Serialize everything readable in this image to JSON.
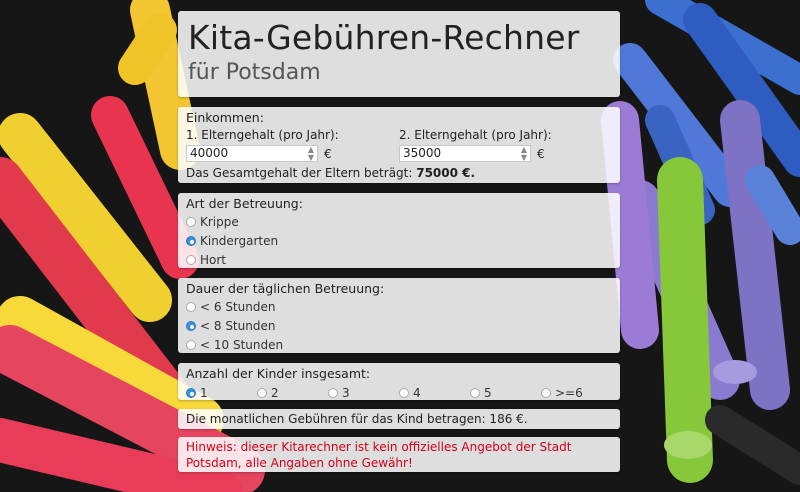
{
  "header": {
    "title": "Kita-Gebühren-Rechner",
    "subtitle": "für Potsdam"
  },
  "income": {
    "title": "Einkommen:",
    "parent1_label": "1. Elterngehalt (pro Jahr):",
    "parent1_value": "40000",
    "parent2_label": "2. Elterngehalt (pro Jahr):",
    "parent2_value": "35000",
    "currency": "€",
    "total_prefix": "Das Gesamtgehalt der Eltern beträgt:",
    "total_value": "75000 €."
  },
  "care_type": {
    "title": "Art der Betreuung:",
    "options": [
      {
        "label": "Krippe",
        "selected": false
      },
      {
        "label": "Kindergarten",
        "selected": true
      },
      {
        "label": "Hort",
        "selected": false
      }
    ]
  },
  "duration": {
    "title": "Dauer der täglichen Betreuung:",
    "options": [
      {
        "label": "< 6 Stunden",
        "selected": false
      },
      {
        "label": "< 8 Stunden",
        "selected": true
      },
      {
        "label": "< 10 Stunden",
        "selected": false
      }
    ]
  },
  "kids": {
    "title": "Anzahl der Kinder insgesamt:",
    "options": [
      {
        "label": "1",
        "selected": true
      },
      {
        "label": "2",
        "selected": false
      },
      {
        "label": "3",
        "selected": false
      },
      {
        "label": "4",
        "selected": false
      },
      {
        "label": "5",
        "selected": false
      },
      {
        "label": ">=6",
        "selected": false
      }
    ]
  },
  "result": {
    "text": "Die monatlichen Gebühren für das Kind betragen: 186 €."
  },
  "note": {
    "text": "Hinweis: dieser Kitarechner ist kein offizielles Angebot der Stadt Potsdam, alle Angaben ohne Gewähr!"
  },
  "colors": {
    "accent": "#3b8fe0",
    "warning": "#d0021b"
  }
}
